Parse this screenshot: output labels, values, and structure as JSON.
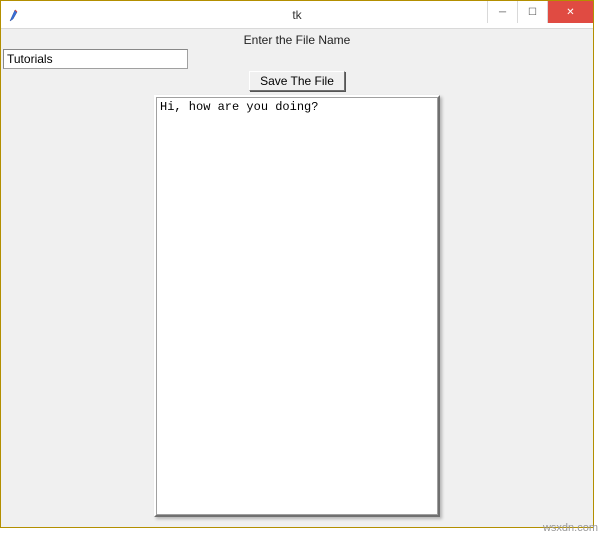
{
  "window": {
    "title": "tk",
    "controls": {
      "min": "─",
      "max": "☐",
      "close": "✕"
    }
  },
  "label": {
    "filename_prompt": "Enter the File Name"
  },
  "filename_input": {
    "value": "Tutorials"
  },
  "save_button": {
    "label": "Save The File"
  },
  "textarea": {
    "value": "Hi, how are you doing?"
  },
  "watermark": "wsxdn.com"
}
